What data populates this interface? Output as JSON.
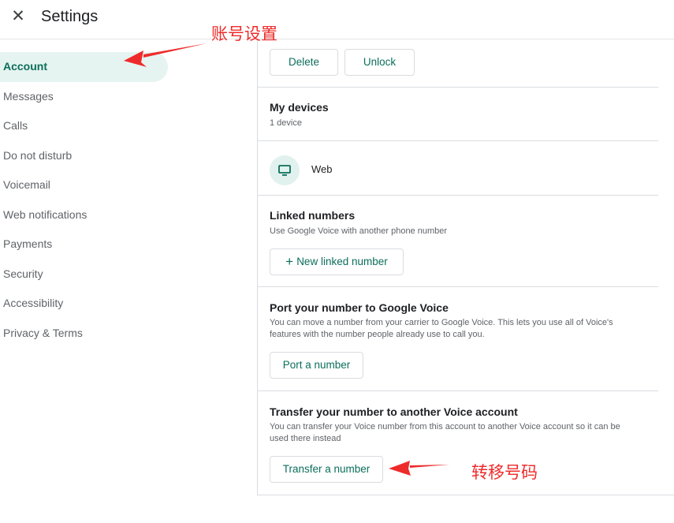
{
  "header": {
    "title": "Settings",
    "close_icon": "close-icon"
  },
  "sidebar": {
    "items": [
      {
        "label": "Account",
        "active": true
      },
      {
        "label": "Messages"
      },
      {
        "label": "Calls"
      },
      {
        "label": "Do not disturb"
      },
      {
        "label": "Voicemail"
      },
      {
        "label": "Web notifications"
      },
      {
        "label": "Payments"
      },
      {
        "label": "Security"
      },
      {
        "label": "Accessibility"
      },
      {
        "label": "Privacy & Terms"
      }
    ]
  },
  "account": {
    "top_buttons": {
      "delete": "Delete",
      "unlock": "Unlock"
    },
    "devices": {
      "title": "My devices",
      "count": "1 device",
      "items": [
        {
          "name": "Web",
          "icon": "monitor-icon"
        }
      ]
    },
    "linked": {
      "title": "Linked numbers",
      "subtitle": "Use Google Voice with another phone number",
      "button": "New linked number",
      "button_icon": "plus-icon"
    },
    "port": {
      "title": "Port your number to Google Voice",
      "subtitle_line1": "You can move a number from your carrier to Google Voice. This lets you use all of Voice's",
      "subtitle_line2": "features with the number people already use to call you.",
      "button": "Port a number"
    },
    "transfer": {
      "title": "Transfer your number to another Voice account",
      "subtitle_line1": "You can transfer your Voice number from this account to another Voice account so it can be",
      "subtitle_line2": "used there instead",
      "button": "Transfer a number"
    }
  },
  "annotations": {
    "account_label": "账号设置",
    "transfer_label": "转移号码"
  },
  "colors": {
    "accent": "#0b6e5b",
    "active_bg": "#e6f4f1",
    "annotation": "#ee2b2b",
    "border": "#dadce0"
  }
}
